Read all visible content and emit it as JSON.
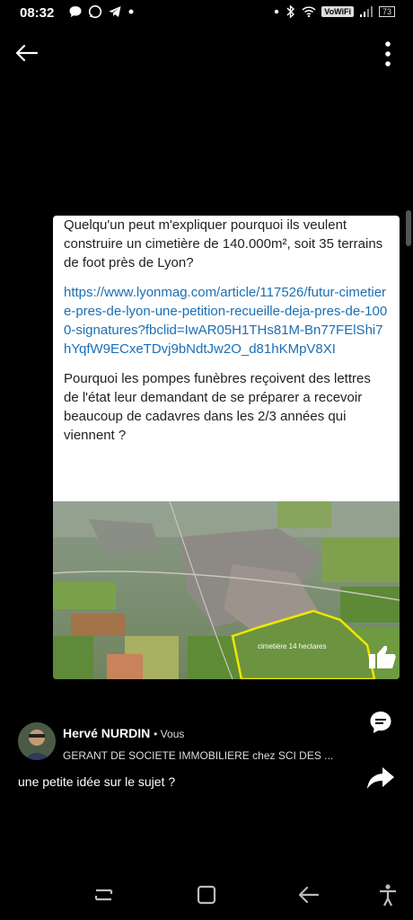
{
  "status_bar": {
    "time": "08:32",
    "network_label": "VoWiFi",
    "battery": "73"
  },
  "post": {
    "paragraph1": "Quelqu'un peut m'expliquer pourquoi ils veulent construire un cimetière de 140.000m², soit 35 terrains de foot près de Lyon?",
    "link": "https://www.lyonmag.com/article/117526/futur-cimetiere-pres-de-lyon-une-petition-recueille-deja-pres-de-1000-signatures?fbclid=IwAR05H1THs81M-Bn77FElShi7hYqfW9ECxeTDvj9bNdtJw2O_d81hKMpV8XI",
    "paragraph2": "Pourquoi les pompes funèbres reçoivent des lettres de l'état leur demandant de se préparer a recevoir beaucoup de cadavres dans les 2/3 années qui viennent ?",
    "map_label": "cimetière 14 hectares"
  },
  "author": {
    "name": "Hervé NURDIN",
    "relation": "• Vous",
    "subtitle": "GERANT DE SOCIETE IMMOBILIERE chez SCI DES ..."
  },
  "caption": "une petite idée sur le sujet ?",
  "icons": {
    "back": "arrow-left-icon",
    "more": "more-vertical-icon",
    "comment": "comment-icon",
    "share": "share-icon",
    "like": "thumbs-up-icon"
  },
  "colors": {
    "background": "#000000",
    "link": "#1b6fb5",
    "highlight_outline": "#f2e600"
  }
}
